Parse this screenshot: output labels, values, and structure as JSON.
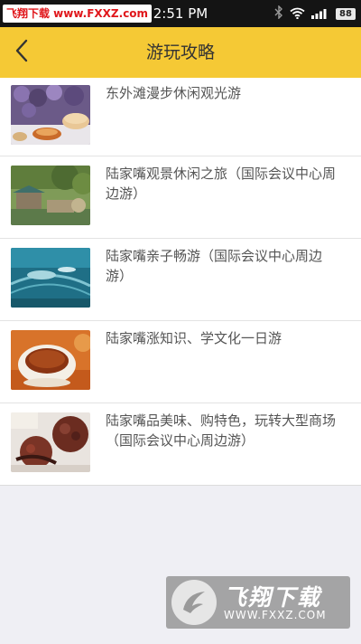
{
  "status_bar": {
    "watermark": "飞翔下载 www.FXXZ.com",
    "time": "2:51 PM",
    "battery": "88"
  },
  "nav": {
    "title": "游玩攻略",
    "back_icon": "chevron-left-icon"
  },
  "list": {
    "items": [
      {
        "title": "东外滩漫步休闲观光游"
      },
      {
        "title": "陆家嘴观景休闲之旅（国际会议中心周边游）"
      },
      {
        "title": "陆家嘴亲子畅游（国际会议中心周边游）"
      },
      {
        "title": "陆家嘴涨知识、学文化一日游"
      },
      {
        "title": "陆家嘴品美味、购特色，玩转大型商场（国际会议中心周边游）"
      }
    ]
  },
  "watermark_logo": {
    "name": "飞翔下载",
    "url": "WWW.FXXZ.COM"
  },
  "colors": {
    "nav_background": "#f5c935",
    "status_bar_background": "#141414",
    "page_background": "#efeff4"
  }
}
